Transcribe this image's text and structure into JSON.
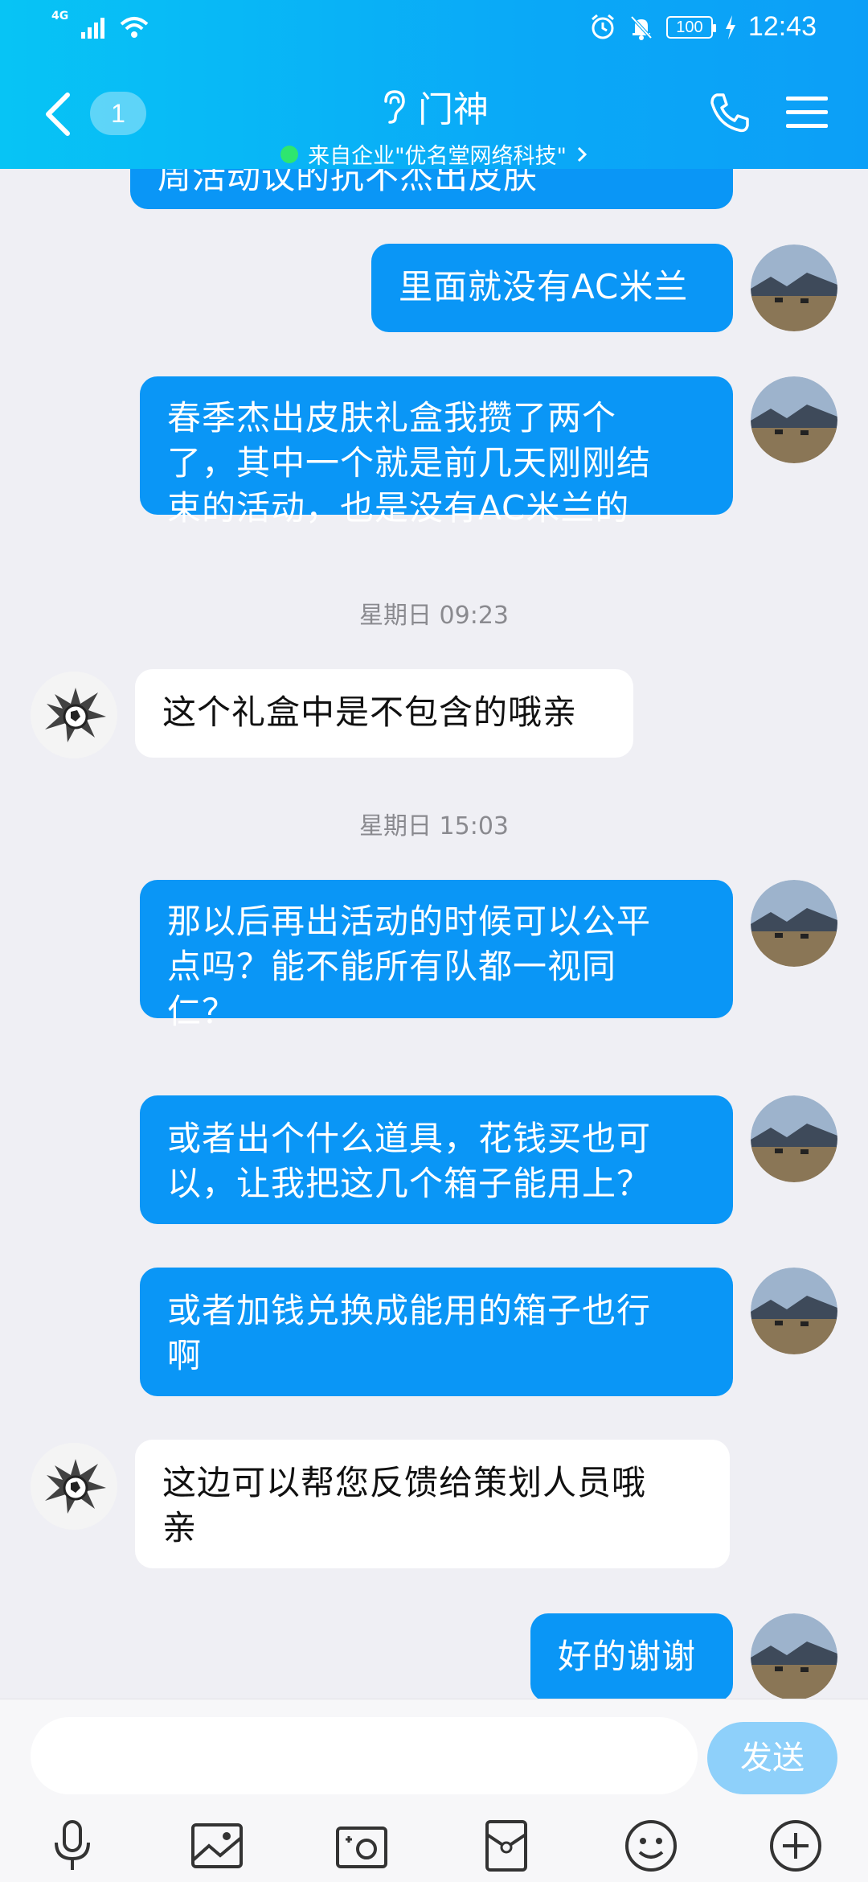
{
  "status_bar": {
    "network": "4G",
    "battery": "100",
    "time": "12:43"
  },
  "header": {
    "unread_count": "1",
    "title": "门神",
    "subtitle": "来自企业\"优名堂网络科技\"",
    "icons": [
      "back-arrow-icon",
      "ear-icon",
      "phone-icon",
      "menu-icon"
    ]
  },
  "messages": [
    {
      "side": "out",
      "text": "周活动议的抗不杰出皮肤"
    },
    {
      "side": "out",
      "text": "里面就没有AC米兰"
    },
    {
      "side": "out",
      "lines": [
        "春季杰出皮肤礼盒我攒了两个",
        "了，其中一个就是前几天刚刚结",
        "束的活动，也是没有AC米兰的"
      ]
    },
    {
      "side": "time",
      "text": "星期日 09:23"
    },
    {
      "side": "in",
      "text": "这个礼盒中是不包含的哦亲"
    },
    {
      "side": "time",
      "text": "星期日 15:03"
    },
    {
      "side": "out",
      "lines": [
        "那以后再出活动的时候可以公平",
        "点吗？能不能所有队都一视同",
        "仁？"
      ]
    },
    {
      "side": "out",
      "lines": [
        "或者出个什么道具，花钱买也可",
        "以，让我把这几个箱子能用上？"
      ]
    },
    {
      "side": "out",
      "lines": [
        "或者加钱兑换成能用的箱子也行",
        "啊"
      ]
    },
    {
      "side": "in",
      "lines": [
        "这边可以帮您反馈给策划人员哦",
        "亲"
      ]
    },
    {
      "side": "out",
      "text": "好的谢谢"
    }
  ],
  "input": {
    "placeholder": "",
    "send_label": "发送"
  },
  "toolbar": [
    "microphone-icon",
    "image-icon",
    "camera-icon",
    "red-packet-icon",
    "emoji-icon",
    "plus-icon"
  ],
  "colors": {
    "header_start": "#07c4f5",
    "header_end": "#0c9ff7",
    "bubble_out": "#0a96f6",
    "bubble_in": "#ffffff",
    "send": "#8ed0fa"
  }
}
